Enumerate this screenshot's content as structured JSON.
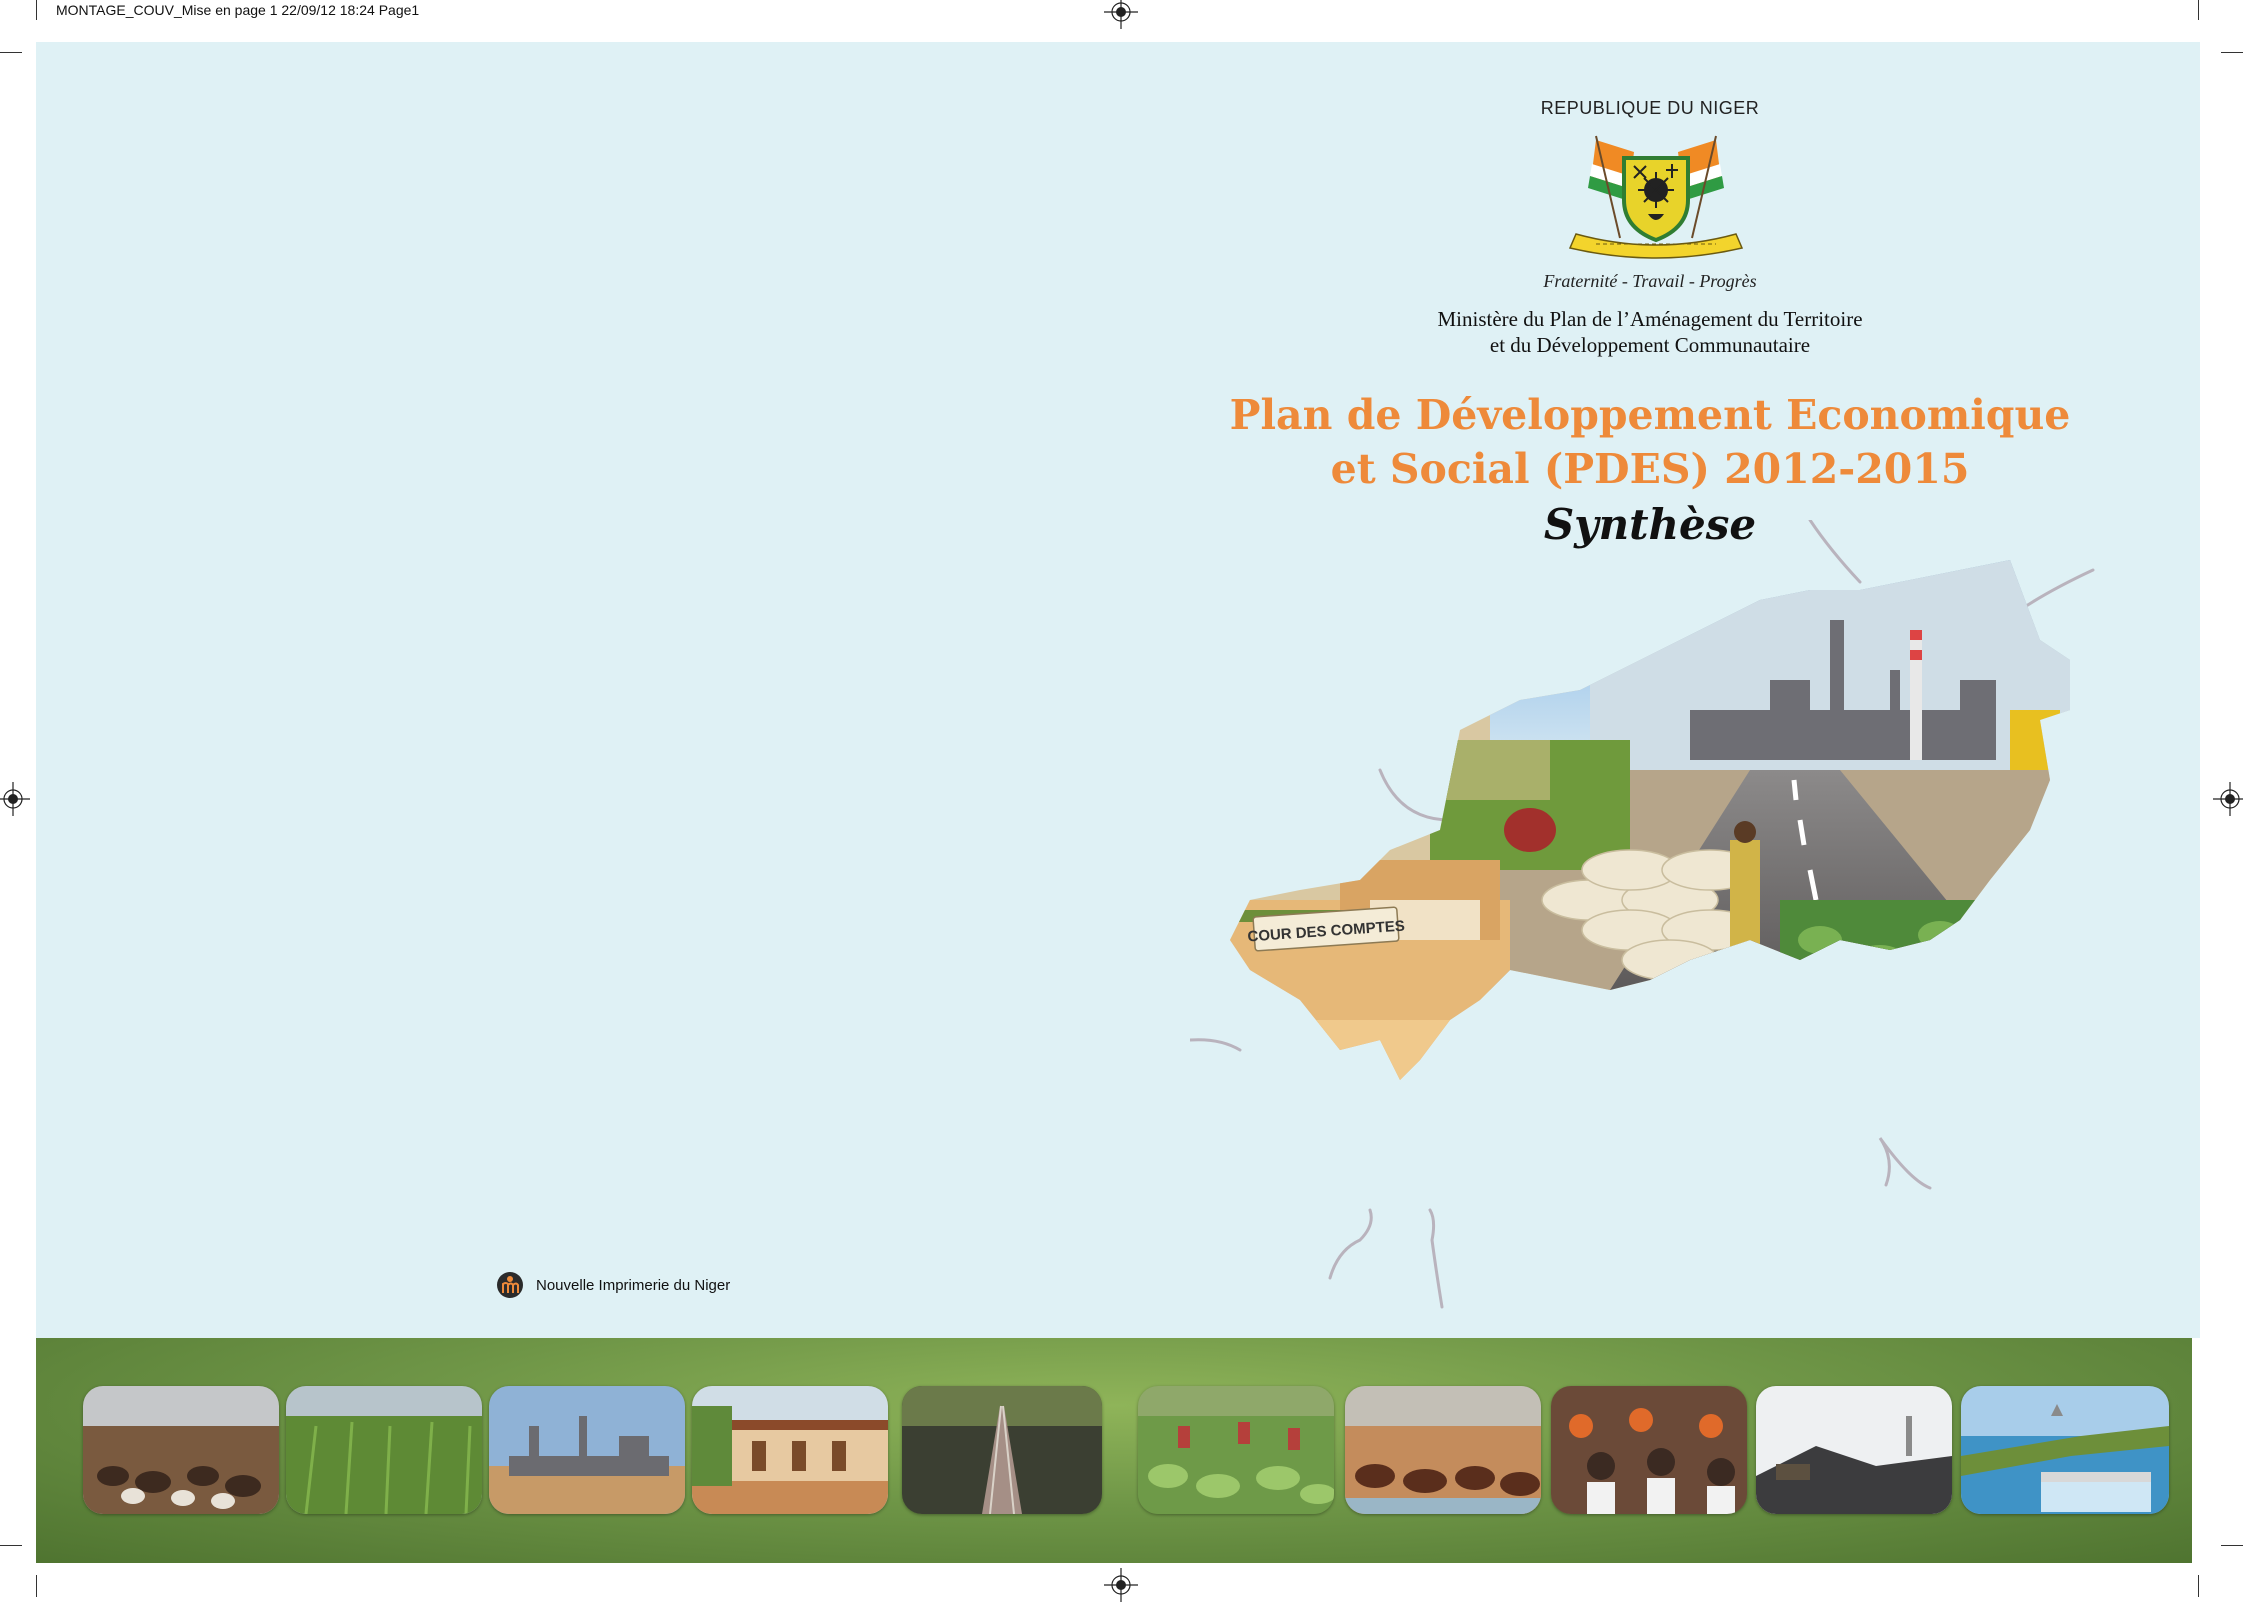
{
  "slug_line": "MONTAGE_COUV_Mise en page 1  22/09/12  18:24  Page1",
  "header": {
    "republic": "REPUBLIQUE DU NIGER",
    "motto": "Fraternité - Travail - Progrès",
    "ministry_line1": "Ministère du Plan de l’Aménagement du Territoire",
    "ministry_line2": "et du Développement Communautaire"
  },
  "title": {
    "line1": "Plan de Développement Economique",
    "line2": "et Social (PDES) 2012-2015",
    "subtitle": "Synthèse"
  },
  "map": {
    "sign_text": "COUR DES COMPTES"
  },
  "publisher": {
    "name": "Nouvelle Imprimerie du Niger"
  },
  "colors": {
    "title_orange": "#ee8a3a",
    "sheet_background": "#dff1f5",
    "band_green": "#6f9647"
  },
  "photo_strip": [
    {
      "icon": "livestock-market-photo"
    },
    {
      "icon": "crop-field-photo"
    },
    {
      "icon": "refinery-photo"
    },
    {
      "icon": "school-building-photo"
    },
    {
      "icon": "railway-photo"
    },
    {
      "icon": "vegetable-garden-photo"
    },
    {
      "icon": "cattle-herd-photo"
    },
    {
      "icon": "classroom-photo"
    },
    {
      "icon": "mining-photo"
    },
    {
      "icon": "dam-photo"
    }
  ]
}
